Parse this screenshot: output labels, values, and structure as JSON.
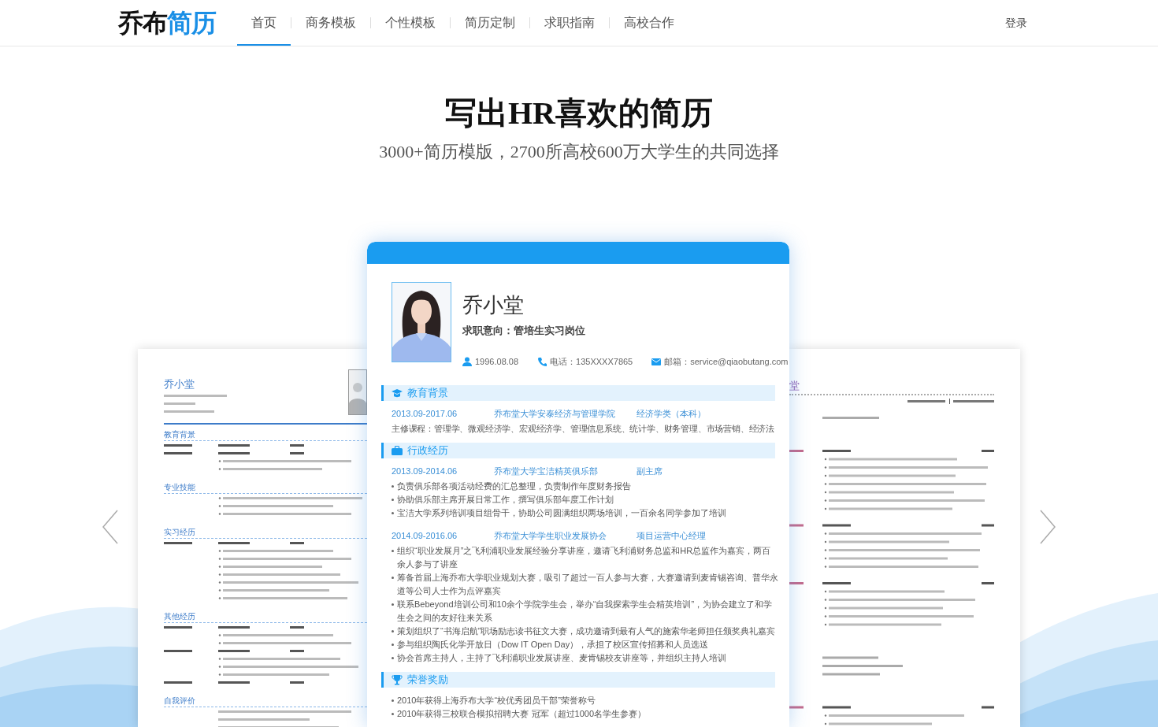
{
  "nav": {
    "logo_dark": "乔布",
    "logo_accent": "简历",
    "items": [
      {
        "label": "首页",
        "selected": true
      },
      {
        "label": "商务模板",
        "selected": false
      },
      {
        "label": "个性模板",
        "selected": false
      },
      {
        "label": "简历定制",
        "selected": false
      },
      {
        "label": "求职指南",
        "selected": false
      },
      {
        "label": "高校合作",
        "selected": false
      }
    ],
    "login": "登录"
  },
  "hero": {
    "title": "写出HR喜欢的简历",
    "subtitle": "3000+简历模版，2700所高校600万大学生的共同选择"
  },
  "left_card": {
    "name": "乔小堂",
    "section_titles": [
      "教育背景",
      "专业技能",
      "实习经历",
      "其他经历",
      "自我评价"
    ]
  },
  "center_card": {
    "name": "乔小堂",
    "objective": "求职意向：管培生实习岗位",
    "info": [
      {
        "kind": "birthday",
        "text": "1996.08.08"
      },
      {
        "kind": "phone",
        "text": "电话：135XXXX7865"
      },
      {
        "kind": "email",
        "text": "邮箱：service@qiaobutang.com"
      }
    ],
    "sections": [
      {
        "kind": "education",
        "title": "教育背景",
        "entries": [
          {
            "date": "2013.09-2017.06",
            "org": "乔布堂大学安泰经济与管理学院",
            "role": "经济学类（本科）",
            "lines": [
              "主修课程：管理学、微观经济学、宏观经济学、管理信息系统、统计学、财务管理、市场营销、经济法"
            ]
          }
        ]
      },
      {
        "kind": "work",
        "title": "行政经历",
        "entries": [
          {
            "date": "2013.09-2014.06",
            "org": "乔布堂大学宝洁精英俱乐部",
            "role": "副主席",
            "bullets": [
              "负责俱乐部各项活动经费的汇总整理，负责制作年度财务报告",
              "协助俱乐部主席开展日常工作，撰写俱乐部年度工作计划",
              "宝洁大学系列培训项目组骨干，协助公司圆满组织两场培训，一百余名同学参加了培训"
            ]
          },
          {
            "date": "2014.09-2016.06",
            "org": "乔布堂大学学生职业发展协会",
            "role": "项目运营中心经理",
            "bullets": [
              "组织“职业发展月”之飞利浦职业发展经验分享讲座，邀请飞利浦财务总监和HR总监作为嘉宾，两百余人参与了讲座",
              "筹备首届上海乔布大学职业规划大赛，吸引了超过一百人参与大赛，大赛邀请到麦肯锡咨询、普华永道等公司人士作为点评嘉宾",
              "联系Bebeyond培训公司和10余个学院学生会，举办“自我探索学生会精英培训”，为协会建立了和学生会之间的友好往来关系",
              "策划组织了“书海启航”职场励志读书征文大赛，成功邀请到最有人气的施索华老师担任颁奖典礼嘉宾",
              "参与组织陶氏化学开放日（Dow IT Open Day），承担了校区宣传招募和人员选送",
              "协会首席主持人，主持了飞利浦职业发展讲座、麦肯锡校友讲座等，并组织主持人培训"
            ]
          }
        ]
      },
      {
        "kind": "honors",
        "title": "荣誉奖励",
        "entries": [
          {
            "bullets": [
              "2010年获得上海乔布大学“校优秀团员干部”荣誉称号",
              "2010年获得三校联合模拟招聘大赛 冠军（超过1000名学生参赛）"
            ]
          }
        ]
      }
    ]
  },
  "right_card": {
    "name_fragment": "堂"
  }
}
